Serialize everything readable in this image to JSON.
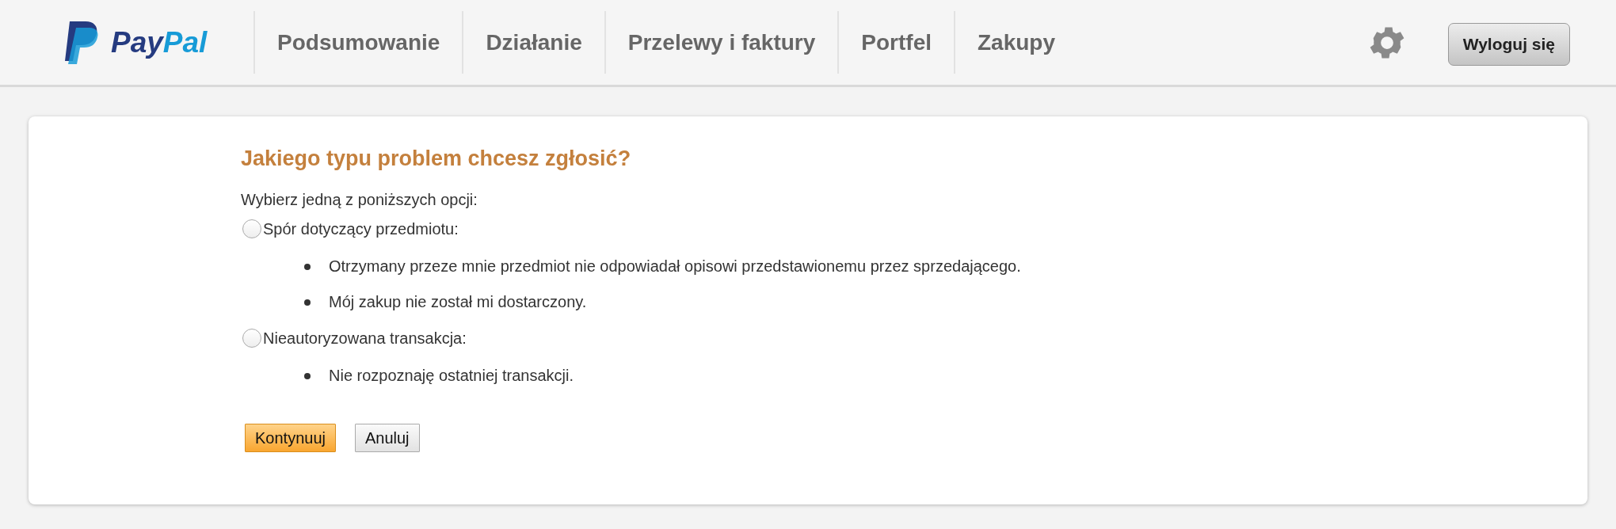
{
  "header": {
    "logo": {
      "text": "Pay",
      "text_accent": "Pal"
    },
    "nav": [
      "Podsumowanie",
      "Działanie",
      "Przelewy i faktury",
      "Portfel",
      "Zakupy"
    ],
    "logout_button": "Wyloguj się"
  },
  "form": {
    "title": "Jakiego typu problem chcesz zgłosić?",
    "instruction": "Wybierz jedną z poniższych opcji:",
    "options": [
      {
        "label": "Spór dotyczący przedmiotu:",
        "selected": false,
        "details": [
          "Otrzymany przeze mnie przedmiot nie odpowiadał opisowi przedstawionemu przez sprzedającego.",
          "Mój zakup nie został mi dostarczony."
        ]
      },
      {
        "label": "Nieautoryzowana transakcja:",
        "selected": false,
        "details": [
          "Nie rozpoznaję ostatniej transakcji."
        ]
      }
    ],
    "buttons": [
      {
        "label": "Kontynuuj",
        "kind": "primary"
      },
      {
        "label": "Anuluj",
        "kind": "secondary"
      }
    ]
  }
}
